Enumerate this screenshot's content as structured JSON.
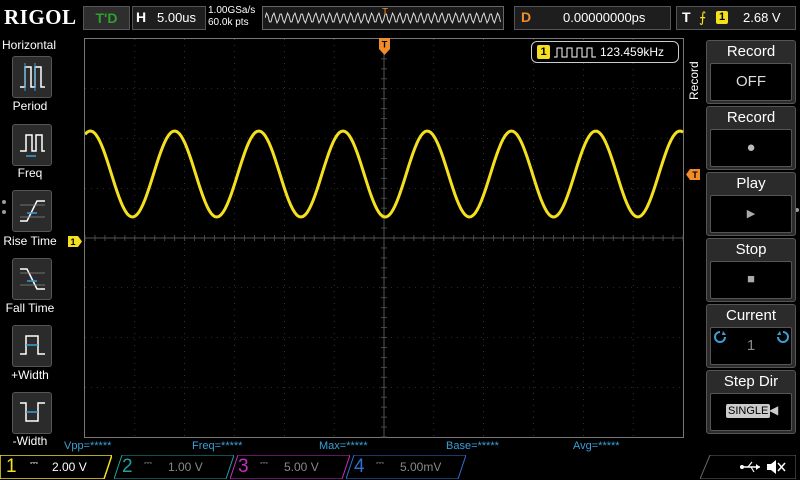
{
  "top": {
    "logo": "RIGOL",
    "trigger_status": "T'D",
    "horizontal_label": "H",
    "timebase": "5.00us",
    "sample_rate": "1.00GSa/s",
    "memory_depth": "60.0k pts",
    "mem_position_marker": "T",
    "delay_label": "D",
    "delay_value": "0.00000000ps",
    "trigger_label": "T",
    "trigger_edge": "⨍",
    "trigger_source": "1",
    "trigger_level": "2.68 V"
  },
  "left_menu": {
    "title": "Horizontal",
    "items": [
      {
        "label": "Period",
        "icon": "period-icon"
      },
      {
        "label": "Freq",
        "icon": "freq-icon"
      },
      {
        "label": "Rise Time",
        "icon": "rise-time-icon"
      },
      {
        "label": "Fall Time",
        "icon": "fall-time-icon"
      },
      {
        "label": "+Width",
        "icon": "positive-width-icon"
      },
      {
        "label": "-Width",
        "icon": "negative-width-icon"
      }
    ]
  },
  "screen": {
    "freq_channel": "1",
    "freq_readout": "123.459kHz",
    "trig_marker": "T",
    "ch1_marker": "1",
    "trace_color": "#f5e020",
    "grid_color": "#555555",
    "waveform_cycles": 7.1
  },
  "right_menu": {
    "vertical_title": "Record",
    "groups": [
      {
        "title": "Record",
        "value": "OFF",
        "icon": ""
      },
      {
        "title": "Record",
        "value": "●",
        "icon": "record-dot-icon"
      },
      {
        "title": "Play",
        "value": "▶",
        "icon": "play-icon"
      },
      {
        "title": "Stop",
        "value": "■",
        "icon": "stop-icon"
      },
      {
        "title": "Current",
        "value": "1",
        "icon": "knob-icon"
      },
      {
        "title": "Step Dir",
        "value": "SINGLE",
        "icon": "direction-icon"
      }
    ]
  },
  "measurements": [
    {
      "label": "Vpp=*****"
    },
    {
      "label": "Freq=*****"
    },
    {
      "label": "Max=*****"
    },
    {
      "label": "Base=*****"
    },
    {
      "label": "Avg=*****"
    }
  ],
  "channels": [
    {
      "num": "1",
      "coupling": "⎓",
      "scale": "2.00 V",
      "color": "#f5e020",
      "active": true
    },
    {
      "num": "2",
      "coupling": "⎓",
      "scale": "1.00 V",
      "color": "#22a0a0",
      "active": false
    },
    {
      "num": "3",
      "coupling": "⎓",
      "scale": "5.00 V",
      "color": "#c030c0",
      "active": false
    },
    {
      "num": "4",
      "coupling": "⎓",
      "scale": "5.00mV",
      "color": "#3070d0",
      "active": false
    }
  ],
  "status_icons": [
    "usb-icon",
    "speaker-mute-icon"
  ]
}
